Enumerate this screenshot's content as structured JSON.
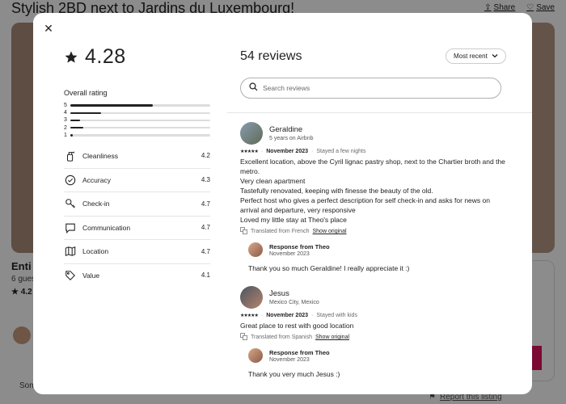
{
  "background": {
    "title": "Stylish 2BD next to Jardins du Luxembourg!",
    "share_label": "Share",
    "save_label": "Save",
    "subtitle": "Enti",
    "guests": "6 gues",
    "rating": "4.2",
    "some": "Som",
    "report_label": "Report this listing"
  },
  "summary": {
    "rating": "4.28",
    "overall_label": "Overall rating",
    "distribution": [
      {
        "star": "5",
        "fraction": 0.59
      },
      {
        "star": "4",
        "fraction": 0.22
      },
      {
        "star": "3",
        "fraction": 0.07
      },
      {
        "star": "2",
        "fraction": 0.09
      },
      {
        "star": "1",
        "fraction": 0.02
      }
    ],
    "categories": [
      {
        "label": "Cleanliness",
        "score": "4.2",
        "icon": "spray-bottle-icon"
      },
      {
        "label": "Accuracy",
        "score": "4.3",
        "icon": "check-circle-icon"
      },
      {
        "label": "Check-in",
        "score": "4.7",
        "icon": "key-icon"
      },
      {
        "label": "Communication",
        "score": "4.7",
        "icon": "chat-bubble-icon"
      },
      {
        "label": "Location",
        "score": "4.7",
        "icon": "map-icon"
      },
      {
        "label": "Value",
        "score": "4.1",
        "icon": "tag-icon"
      }
    ]
  },
  "reviews_panel": {
    "count_label": "54 reviews",
    "sort_label": "Most recent",
    "search_placeholder": "Search reviews",
    "reviews": [
      {
        "name": "Geraldine",
        "subtitle": "5 years on Airbnb",
        "stars": "★★★★★",
        "date": "November 2023",
        "stay": "Stayed a few nights",
        "lines": [
          "Excellent location, above the Cyril lignac pastry shop, next to the Chartier broth and the metro.",
          "Very clean apartment",
          "Tastefully renovated, keeping with finesse the beauty of the old.",
          "Perfect host who gives a perfect description for self check-in and asks for news on arrival and departure, very responsive",
          "Loved my little stay at Theo's place"
        ],
        "translated": "Translated from French",
        "show_original": "Show original",
        "response": {
          "title": "Response from Theo",
          "date": "November 2023",
          "text": "Thank you so much Geraldine! I really appreciate it :)"
        }
      },
      {
        "name": "Jesus",
        "subtitle": "Mexico City, Mexico",
        "stars": "★★★★★",
        "date": "November 2023",
        "stay": "Stayed with kids",
        "lines": [
          "Great place to rest with good location"
        ],
        "translated": "Translated from Spanish",
        "show_original": "Show original",
        "response": {
          "title": "Response from Theo",
          "date": "November 2023",
          "text": "Thank you very much Jesus :)"
        }
      }
    ]
  }
}
